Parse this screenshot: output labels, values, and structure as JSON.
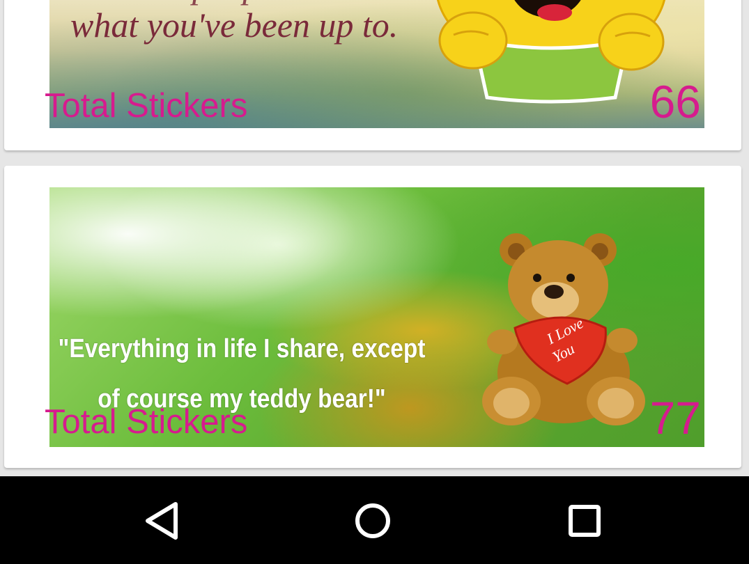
{
  "cards": [
    {
      "banner_text": "what you've been up to.",
      "banner_text_cut": "I wanna people wonder",
      "label": "Total Stickers",
      "count": "66",
      "art_icon": "smiley-holding-sign-icon"
    },
    {
      "banner_text_line1": "\"Everything in life I share, except",
      "banner_text_line2": "of course my teddy bear!\"",
      "heart_text_1": "I Love",
      "heart_text_2": "You",
      "label": "Total Stickers",
      "count": "77",
      "art_icon": "teddy-bear-icon"
    }
  ],
  "navigation": {
    "back_icon": "back-icon",
    "home_icon": "home-icon",
    "recents_icon": "recents-icon"
  },
  "colors": {
    "accent": "#d61b8e",
    "navbar": "#000000"
  }
}
